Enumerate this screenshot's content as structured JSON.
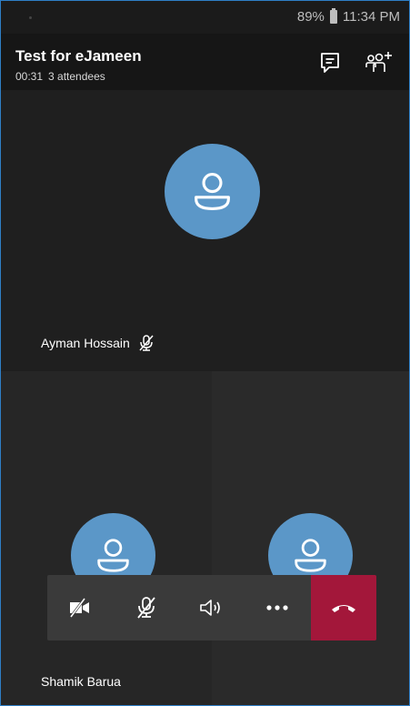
{
  "status_bar": {
    "battery": "89%",
    "time": "11:34 PM"
  },
  "header": {
    "title": "Test for eJameen",
    "duration": "00:31",
    "attendees": "3 attendees",
    "chat_icon": "chat-icon",
    "people_icon": "add-people-icon"
  },
  "participants": [
    {
      "name": "Ayman Hossain",
      "muted": true
    },
    {
      "name": "Shamik Barua",
      "muted": false
    },
    {
      "name": "",
      "muted": false
    }
  ],
  "controls": {
    "items": [
      "camera-off-icon",
      "mic-off-icon",
      "speaker-icon",
      "more-options-icon",
      "hang-up-icon"
    ]
  },
  "colors": {
    "avatar": "#5b97c8",
    "hangup": "#a3173a",
    "frame_border": "#2f7fc6"
  }
}
